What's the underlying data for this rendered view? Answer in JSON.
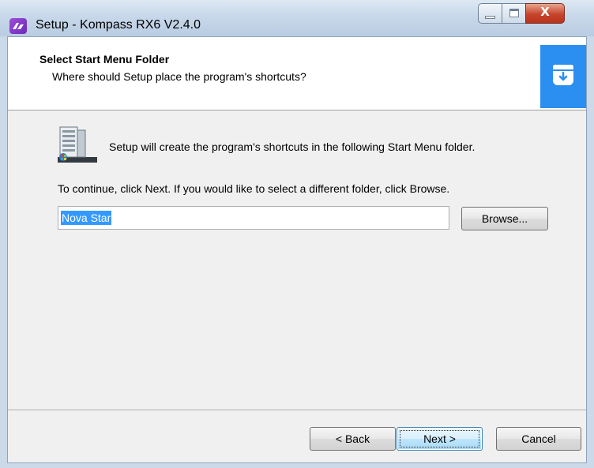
{
  "window": {
    "title": "Setup - Kompass RX6 V2.4.0",
    "controls": {
      "minimize": "minimize",
      "maximize": "maximize",
      "close_glyph": "X"
    }
  },
  "header": {
    "title": "Select Start Menu Folder",
    "subtitle": "Where should Setup place the program's shortcuts?",
    "icon": "install-box-icon",
    "accent_color": "#2a8ff0"
  },
  "body": {
    "info_text": "Setup will create the program's shortcuts in the following Start Menu folder.",
    "continue_text": "To continue, click Next. If you would like to select a different folder, click Browse.",
    "folder_value": "Nova Star",
    "browse_label": "Browse..."
  },
  "footer": {
    "back_label": "< Back",
    "next_label": "Next >",
    "cancel_label": "Cancel"
  }
}
